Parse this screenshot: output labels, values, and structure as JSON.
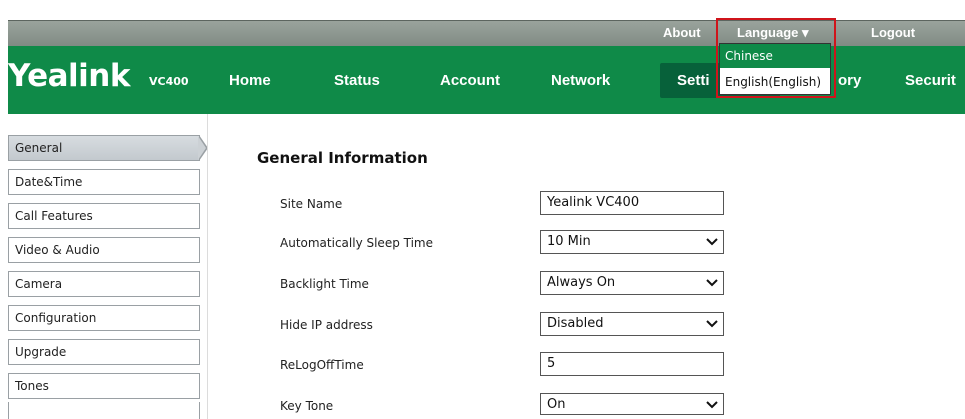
{
  "topbar": {
    "about": "About",
    "language": "Language ▾",
    "logout": "Logout"
  },
  "brand": {
    "logo": "Yealink",
    "model": "VC400"
  },
  "nav": {
    "home": "Home",
    "status": "Status",
    "account": "Account",
    "network": "Network",
    "settings": "Setti",
    "directory": "ory",
    "security": "Securit"
  },
  "language_menu": {
    "options": [
      "Chinese",
      "English(English)"
    ],
    "selected": "Chinese"
  },
  "sidebar": {
    "items": [
      {
        "label": "General"
      },
      {
        "label": "Date&Time"
      },
      {
        "label": "Call Features"
      },
      {
        "label": "Video & Audio"
      },
      {
        "label": "Camera"
      },
      {
        "label": "Configuration"
      },
      {
        "label": "Upgrade"
      },
      {
        "label": "Tones"
      }
    ]
  },
  "content": {
    "section_title": "General Information",
    "rows": [
      {
        "label": "Site Name",
        "value": "Yealink VC400",
        "type": "text"
      },
      {
        "label": "Automatically Sleep Time",
        "value": "10 Min",
        "type": "select"
      },
      {
        "label": "Backlight Time",
        "value": "Always On",
        "type": "select"
      },
      {
        "label": "Hide IP address",
        "value": "Disabled",
        "type": "select"
      },
      {
        "label": "ReLogOffTime",
        "value": "5",
        "type": "text"
      },
      {
        "label": "Key Tone",
        "value": "On",
        "type": "select"
      }
    ]
  },
  "colors": {
    "brand_green": "#0f8a48",
    "active_tab": "#07613a",
    "highlight_red": "#d0141b"
  }
}
